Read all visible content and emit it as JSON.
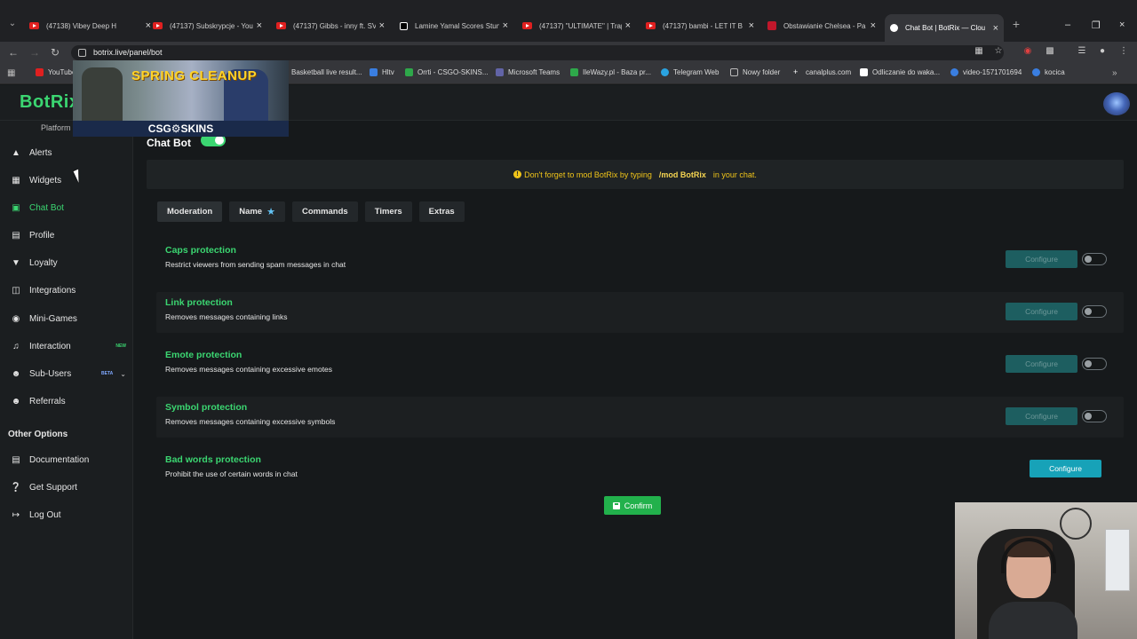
{
  "browser": {
    "tabs": [
      {
        "title": "(47138) Vibey Deep H",
        "icon": "youtube-icon"
      },
      {
        "title": "(47137) Subskrypcje - You",
        "icon": "youtube-icon"
      },
      {
        "title": "(47137) Gibbs - inny ft. SV",
        "icon": "youtube-icon"
      },
      {
        "title": "Lamine Yamal Scores Stun",
        "icon": "tiktok-icon"
      },
      {
        "title": "(47137) \"ULTIMATE\" | Trap",
        "icon": "youtube-icon"
      },
      {
        "title": "(47137) bambi - LET IT B",
        "icon": "youtube-icon"
      },
      {
        "title": "Obstawianie Chelsea - Pa",
        "icon": "bet-icon"
      },
      {
        "title": "Chat Bot | BotRix — Clou",
        "icon": "botrix-icon",
        "active": true
      }
    ],
    "url": "botrix.live/panel/bot",
    "bookmarks": [
      {
        "label": "YouTube",
        "color": "#e02020"
      },
      {
        "label": "Basketball live result...",
        "color": "#e8a020"
      },
      {
        "label": "Hltv",
        "color": "#3a7ee0"
      },
      {
        "label": "Orrti - CSGO-SKINS...",
        "color": "#2ea84a"
      },
      {
        "label": "Microsoft Teams",
        "color": "#6264a7"
      },
      {
        "label": "IleWazy.pl - Baza pr...",
        "color": "#2ea84a"
      },
      {
        "label": "Telegram Web",
        "color": "#2aa3e0"
      },
      {
        "label": "Nowy folder",
        "color": "#bbbbbb"
      },
      {
        "label": "canalplus.com",
        "color": "#ffffff"
      },
      {
        "label": "Odliczanie do waka...",
        "color": "#ffffff"
      },
      {
        "label": "video-1571701694",
        "color": "#3a7ee0"
      },
      {
        "label": "kocica",
        "color": "#3a7ee0"
      }
    ]
  },
  "app": {
    "logo": "BotRix",
    "platform_label": "Platform",
    "page_title": "Chat Bot",
    "ad": {
      "headline": "SPRING CLEANUP",
      "brand": "CSG⚙SKINS"
    }
  },
  "sidebar": {
    "items": [
      {
        "label": "Alerts",
        "icon": "warning-icon"
      },
      {
        "label": "Widgets",
        "icon": "widgets-icon"
      },
      {
        "label": "Chat Bot",
        "icon": "robot-icon",
        "active": true
      },
      {
        "label": "Profile",
        "icon": "id-card-icon"
      },
      {
        "label": "Loyalty",
        "icon": "trophy-icon"
      },
      {
        "label": "Integrations",
        "icon": "integrations-icon"
      },
      {
        "label": "Mini-Games",
        "icon": "gamepad-icon"
      },
      {
        "label": "Interaction",
        "icon": "music-note-icon",
        "badge": "NEW"
      },
      {
        "label": "Sub-Users",
        "icon": "users-icon",
        "badge": "BETA",
        "chevron": true
      },
      {
        "label": "Referrals",
        "icon": "user-group-icon"
      }
    ],
    "other_header": "Other Options",
    "other_items": [
      {
        "label": "Documentation",
        "icon": "document-icon"
      },
      {
        "label": "Get Support",
        "icon": "question-icon"
      },
      {
        "label": "Log Out",
        "icon": "logout-icon"
      }
    ]
  },
  "notice": {
    "prefix": "Don't forget to mod BotRix by typing",
    "command": "/mod BotRix",
    "suffix": "in your chat."
  },
  "tabs": [
    {
      "label": "Moderation",
      "active": true
    },
    {
      "label": "Name",
      "star": true
    },
    {
      "label": "Commands"
    },
    {
      "label": "Timers"
    },
    {
      "label": "Extras"
    }
  ],
  "protections": [
    {
      "title": "Caps protection",
      "description": "Restrict viewers from sending spam messages in chat",
      "configure": "Configure",
      "enabled": false
    },
    {
      "title": "Link protection",
      "description": "Removes messages containing links",
      "configure": "Configure",
      "enabled": false
    },
    {
      "title": "Emote protection",
      "description": "Removes messages containing excessive emotes",
      "configure": "Configure",
      "enabled": false
    },
    {
      "title": "Symbol protection",
      "description": "Removes messages containing excessive symbols",
      "configure": "Configure",
      "enabled": false
    },
    {
      "title": "Bad words protection",
      "description": "Prohibit the use of certain words in chat",
      "configure": "Configure",
      "enabled": true
    }
  ],
  "confirm_label": "Confirm",
  "colors": {
    "accent": "#3bd671",
    "configure_active": "#17a2b8",
    "notice": "#f0c419"
  }
}
